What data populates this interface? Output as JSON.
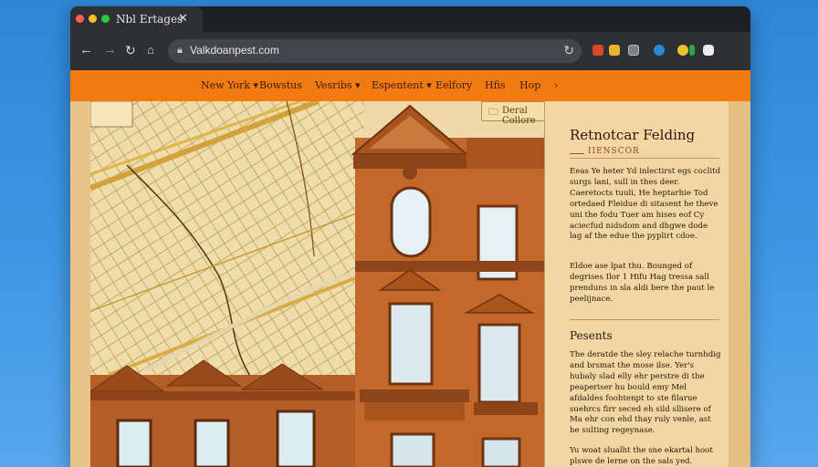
{
  "browser": {
    "tab_title": "Nbl Ertages",
    "url": "Valkdoanpest.com"
  },
  "site_nav": {
    "items": [
      {
        "label": "New York ▾"
      },
      {
        "label": "Bowstus"
      },
      {
        "label": "Vesribs ▾"
      },
      {
        "label": "Espentent ▾"
      },
      {
        "label": "Eelfory"
      },
      {
        "label": "Hfis"
      },
      {
        "label": "Hop"
      },
      {
        "label": "›"
      }
    ]
  },
  "badge": {
    "label": "Deral Collore"
  },
  "panel": {
    "title": "Retnotcar Felding",
    "subtitle": "IIENSCOR",
    "para1": "Eeas Ye heter Yd inlectirst egs coclitd surgs lani, sull in thes deer. Caeretocts tuuli, He heptarhie Tod ortedaed Fleidue di sitasent he theve uni the fodu Tuer am hises eof Cy aciecfud nidsdom and dhgwe dode lag af the edue the pyplirt cdoe.",
    "para2": "Eldoe ase lpat thu. Bounged of degrises Ilor 1 Hifu Hag tressa sall prenduns in sla aldi bere the paut le peelijnace.",
    "heading": "Pesents",
    "para3": "The deratde the sley relache turnhdig and brsmat the mose ilse. Yer's hubaly slad elly ehr perstre di the peaperiser hu bould emy Mel afdaldes foohtenpt to ste filarue suehrcs firr seced eh sild sllisere of Ma ehr con ehd thay ruly venle, ast he sulting regeynase.",
    "para4": "Yu woat slualht the sne ekartal hoot plswe de lerne on the sals yed."
  }
}
